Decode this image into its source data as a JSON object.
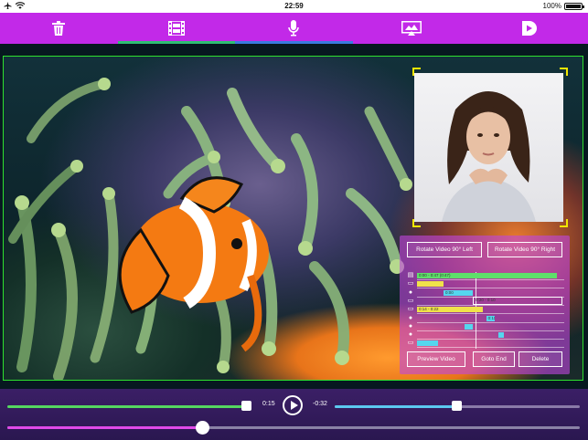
{
  "status_bar": {
    "carrier_icon": "airplane-icon",
    "wifi_icon": "wifi-icon",
    "time": "22:59",
    "battery_percent": "100%",
    "battery_level": 1.0
  },
  "toolbar": {
    "items": [
      {
        "name": "trash-icon"
      },
      {
        "name": "film-icon"
      },
      {
        "name": "microphone-icon"
      },
      {
        "name": "screen-export-icon"
      },
      {
        "name": "app-logo-icon"
      }
    ],
    "selected_indicators": [
      "none",
      "green",
      "blue",
      "none",
      "none"
    ]
  },
  "panel": {
    "rotate_left_label": "Rotate Video 90° Left",
    "rotate_right_label": "Rotate Video 90° Right",
    "preview_label": "Preview Video",
    "goto_end_label": "Goto End",
    "delete_label": "Delete",
    "timeline_rows": [
      {
        "icon": "film-icon",
        "segments": [
          {
            "label": "0:00 - 0:47 (0:47)",
            "color": "green",
            "start": 0.0,
            "end": 0.95
          }
        ]
      },
      {
        "icon": "image-icon",
        "segments": [
          {
            "label": "",
            "color": "yellow",
            "start": 0.0,
            "end": 0.18
          }
        ]
      },
      {
        "icon": "microphone-icon",
        "segments": [
          {
            "label": "0:00",
            "color": "cyan",
            "start": 0.18,
            "end": 0.38
          }
        ]
      },
      {
        "icon": "image-icon",
        "segments": [
          {
            "label": "0:20 - 0:10",
            "color": "outline",
            "start": 0.38,
            "end": 0.99
          }
        ]
      },
      {
        "icon": "image-icon",
        "segments": [
          {
            "label": "0:14 - 0:22",
            "color": "yellow",
            "start": 0.0,
            "end": 0.45
          }
        ]
      },
      {
        "icon": "microphone-icon",
        "segments": [
          {
            "label": "0:11",
            "color": "cyan",
            "start": 0.47,
            "end": 0.53
          }
        ]
      },
      {
        "icon": "microphone-icon",
        "segments": [
          {
            "label": "",
            "color": "cyan",
            "start": 0.32,
            "end": 0.38
          }
        ]
      },
      {
        "icon": "microphone-icon",
        "segments": [
          {
            "label": "",
            "color": "cyan",
            "start": 0.55,
            "end": 0.59
          }
        ]
      },
      {
        "icon": "image-icon",
        "segments": [
          {
            "label": "",
            "color": "cyan",
            "start": 0.0,
            "end": 0.14
          }
        ]
      }
    ]
  },
  "playback": {
    "elapsed": "0:15",
    "remaining": "-0:32",
    "progress_fraction": 0.32,
    "zoom_fraction": 0.34
  }
}
